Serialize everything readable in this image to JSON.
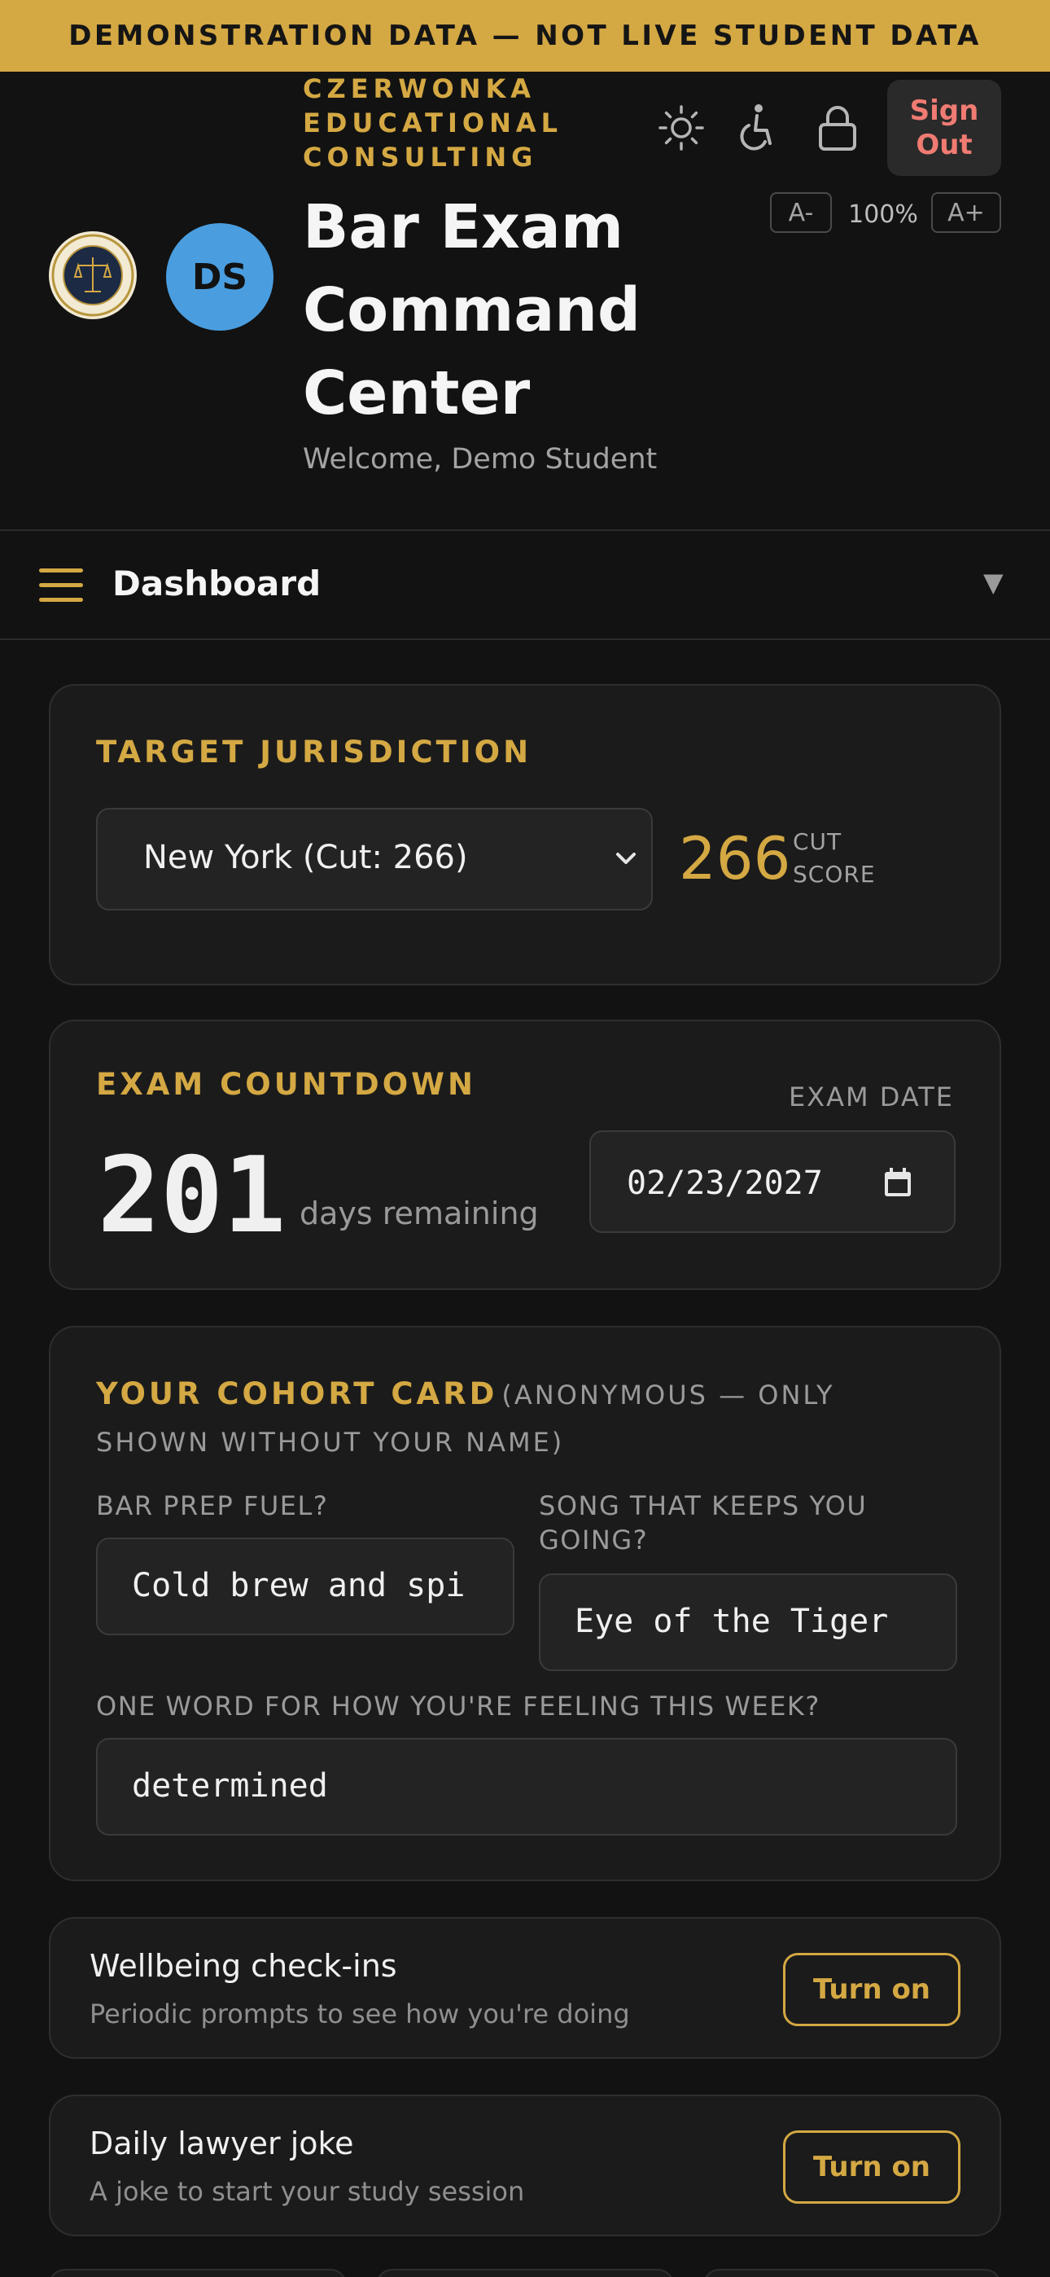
{
  "banner": {
    "text": "DEMONSTRATION DATA — NOT LIVE STUDENT DATA"
  },
  "header": {
    "brand_name": "CZERWONKA EDUCATIONAL CONSULTING",
    "title": "Bar Exam Command Center",
    "welcome": "Welcome, Demo Student",
    "avatar_initials": "DS",
    "sign_out": "Sign Out",
    "zoom": {
      "decrease": "A-",
      "value": "100%",
      "increase": "A+"
    },
    "icons": [
      "sun-icon",
      "accessibility-icon",
      "lock-icon"
    ]
  },
  "nav": {
    "current": "Dashboard"
  },
  "jurisdiction": {
    "title": "TARGET JURISDICTION",
    "selected": "New York (Cut: 266)",
    "cut_score": "266",
    "cut_label_1": "CUT",
    "cut_label_2": "SCORE"
  },
  "countdown": {
    "title": "EXAM COUNTDOWN",
    "days": "201",
    "days_label": "days remaining",
    "exam_date_label": "EXAM DATE",
    "exam_date": "02/23/2027"
  },
  "cohort": {
    "title": "YOUR COHORT CARD",
    "subtitle": "(ANONYMOUS — ONLY SHOWN WITHOUT YOUR NAME)",
    "fuel_label": "BAR PREP FUEL?",
    "fuel_value": "Cold brew and spi",
    "song_label": "SONG THAT KEEPS YOU GOING?",
    "song_value": "Eye of the Tiger",
    "feeling_label": "ONE WORD FOR HOW YOU'RE FEELING THIS WEEK?",
    "feeling_value": "determined"
  },
  "toggles": [
    {
      "title": "Wellbeing check-ins",
      "subtitle": "Periodic prompts to see how you're doing",
      "button": "Turn on"
    },
    {
      "title": "Daily lawyer joke",
      "subtitle": "A joke to start your study session",
      "button": "Turn on"
    }
  ],
  "colors": {
    "accent": "#d4a843",
    "background": "#121212",
    "card": "#1b1b1b",
    "sign_out": "#ef7b72",
    "avatar": "#4a9ee0"
  }
}
